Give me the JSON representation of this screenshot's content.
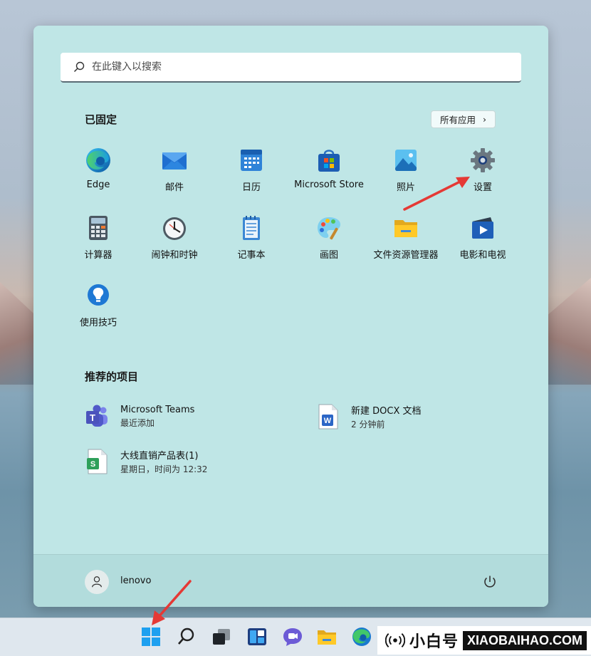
{
  "search": {
    "placeholder": "在此键入以搜索"
  },
  "pinned": {
    "title": "已固定",
    "all_apps_label": "所有应用",
    "all_apps_chevron": "›",
    "apps": [
      {
        "label": "Edge",
        "icon": "edge-icon"
      },
      {
        "label": "邮件",
        "icon": "mail-icon"
      },
      {
        "label": "日历",
        "icon": "calendar-icon"
      },
      {
        "label": "Microsoft Store",
        "icon": "store-icon"
      },
      {
        "label": "照片",
        "icon": "photos-icon"
      },
      {
        "label": "设置",
        "icon": "settings-gear-icon"
      },
      {
        "label": "计算器",
        "icon": "calculator-icon"
      },
      {
        "label": "闹钟和时钟",
        "icon": "clock-icon"
      },
      {
        "label": "记事本",
        "icon": "notepad-icon"
      },
      {
        "label": "画图",
        "icon": "paint-palette-icon"
      },
      {
        "label": "文件资源管理器",
        "icon": "folder-icon"
      },
      {
        "label": "电影和电视",
        "icon": "movies-tv-icon"
      },
      {
        "label": "使用技巧",
        "icon": "tips-lightbulb-icon"
      }
    ]
  },
  "recommended": {
    "title": "推荐的项目",
    "items": [
      {
        "name": "Microsoft Teams",
        "sub": "最近添加",
        "icon": "teams-icon"
      },
      {
        "name": "新建 DOCX 文档",
        "sub": "2 分钟前",
        "icon": "word-doc-icon"
      },
      {
        "name": "大线直销产品表(1)",
        "sub": "星期日，时间为 12:32",
        "icon": "spreadsheet-icon"
      }
    ]
  },
  "footer": {
    "user_name": "lenovo"
  },
  "taskbar": {
    "icons": [
      "windows-start-icon",
      "search-icon",
      "task-view-icon",
      "widgets-icon",
      "chat-icon",
      "file-explorer-icon",
      "edge-icon"
    ]
  },
  "watermark": {
    "cn": "小白号",
    "en": "XIAOBAIHAO.COM"
  },
  "colors": {
    "menu_bg": "#bfe6e6",
    "accent": "#0078d4",
    "arrow": "#e53935"
  }
}
